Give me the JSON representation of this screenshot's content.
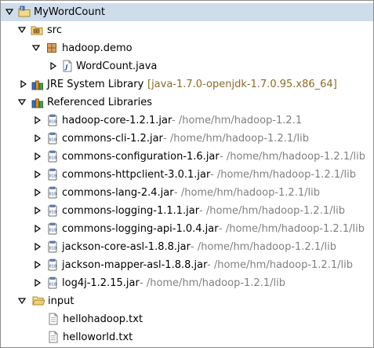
{
  "tree": {
    "project": {
      "label": "MyWordCount"
    },
    "src": {
      "label": "src"
    },
    "package": {
      "label": "hadoop.demo"
    },
    "java_file": {
      "label": "WordCount.java"
    },
    "jre": {
      "label": "JRE System Library",
      "decoration": "[java-1.7.0-openjdk-1.7.0.95.x86_64]"
    },
    "ref_libs": {
      "label": "Referenced Libraries"
    },
    "jars": [
      {
        "name": "hadoop-core-1.2.1.jar",
        "path": " - /home/hm/hadoop-1.2.1"
      },
      {
        "name": "commons-cli-1.2.jar",
        "path": " - /home/hm/hadoop-1.2.1/lib"
      },
      {
        "name": "commons-configuration-1.6.jar",
        "path": " - /home/hm/hadoop-1.2.1/lib"
      },
      {
        "name": "commons-httpclient-3.0.1.jar",
        "path": " - /home/hm/hadoop-1.2.1/lib"
      },
      {
        "name": "commons-lang-2.4.jar",
        "path": " - /home/hm/hadoop-1.2.1/lib"
      },
      {
        "name": "commons-logging-1.1.1.jar",
        "path": " - /home/hm/hadoop-1.2.1/lib"
      },
      {
        "name": "commons-logging-api-1.0.4.jar",
        "path": " - /home/hm/hadoop-1.2.1/lib"
      },
      {
        "name": "jackson-core-asl-1.8.8.jar",
        "path": " - /home/hm/hadoop-1.2.1/lib"
      },
      {
        "name": "jackson-mapper-asl-1.8.8.jar",
        "path": " - /home/hm/hadoop-1.2.1/lib"
      },
      {
        "name": "log4j-1.2.15.jar",
        "path": " - /home/hm/hadoop-1.2.1/lib"
      }
    ],
    "input": {
      "label": "input"
    },
    "files": [
      {
        "name": "hellohadoop.txt"
      },
      {
        "name": "helloworld.txt"
      }
    ]
  },
  "colors": {
    "selection": "#cfddeb",
    "decoration": "#8b6b2c",
    "path": "#808080",
    "folder": "#e8c56a"
  },
  "icons": {
    "expanded": "triangle-down-icon",
    "collapsed": "triangle-right-icon",
    "project": "java-project-icon",
    "src": "source-folder-icon",
    "package": "package-icon",
    "java_file": "java-file-icon",
    "library": "library-icon",
    "jar": "jar-icon",
    "folder": "folder-icon",
    "text_file": "text-file-icon"
  }
}
